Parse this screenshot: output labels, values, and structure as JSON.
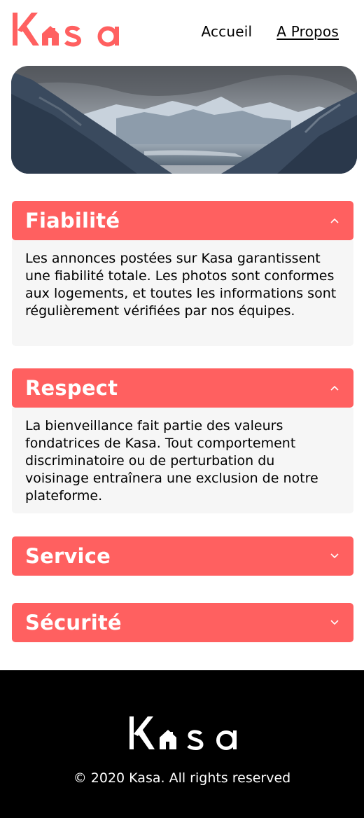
{
  "header": {
    "logo_text": "Kasa",
    "nav": [
      {
        "label": "Accueil",
        "active": false
      },
      {
        "label": "A Propos",
        "active": true
      }
    ]
  },
  "colors": {
    "brand": "#FF6060",
    "panel_background": "#F6F6F6",
    "footer_background": "#000000"
  },
  "sections": [
    {
      "title": "Fiabilité",
      "open": true,
      "icon": "chevron-up-icon",
      "body": "Les annonces postées sur Kasa garantissent une fiabilité totale. Les photos sont conformes aux logements, et toutes les informations sont régulièrement vérifiées par nos équipes."
    },
    {
      "title": "Respect",
      "open": true,
      "icon": "chevron-up-icon",
      "body": "La bienveillance fait partie des valeurs fondatrices de Kasa. Tout comportement discriminatoire ou de perturbation du voisinage entraînera une exclusion de notre plateforme."
    },
    {
      "title": "Service",
      "open": false,
      "icon": "chevron-down-icon"
    },
    {
      "title": "Sécurité",
      "open": false,
      "icon": "chevron-down-icon"
    }
  ],
  "footer": {
    "logo_text": "Kasa",
    "copyright": "© 2020 Kasa. All rights reserved"
  }
}
